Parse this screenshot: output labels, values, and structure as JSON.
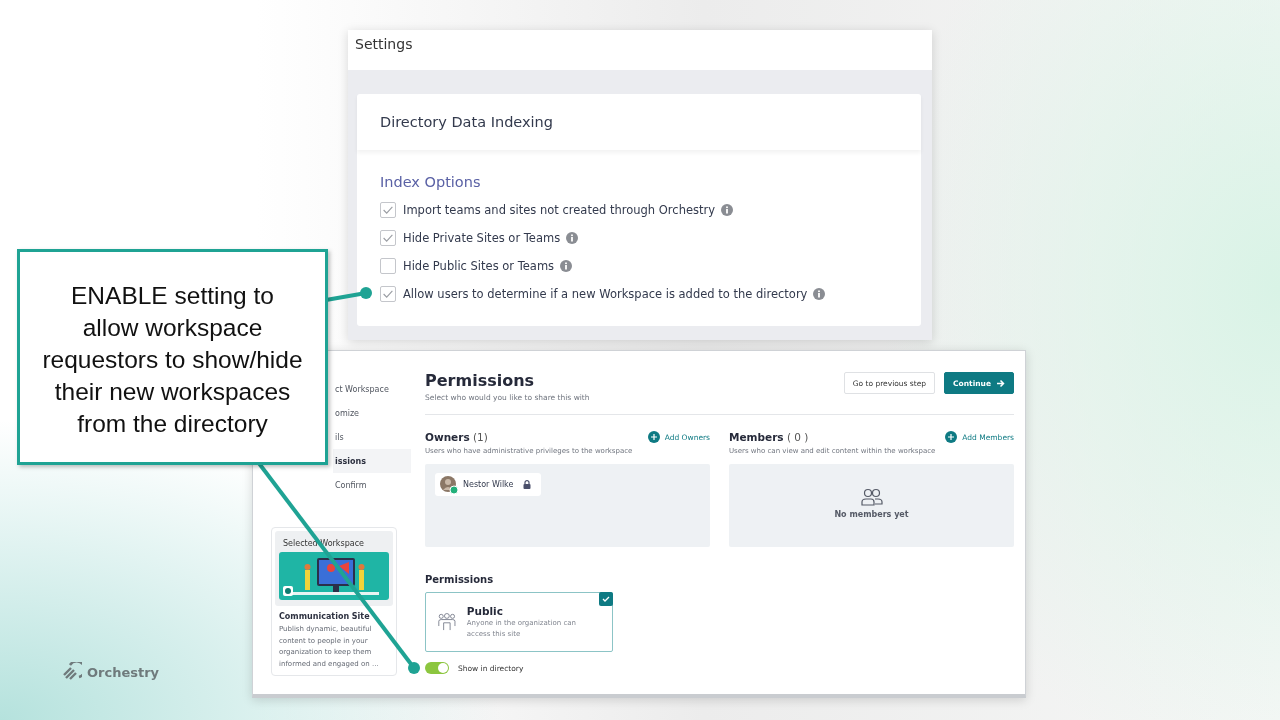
{
  "slide": {
    "callout": {
      "text": "ENABLE setting to allow workspace requestors to show/hide their new workspaces from the directory"
    },
    "logo": {
      "text": "Orchestry"
    }
  },
  "settings_window": {
    "title": "Settings",
    "section": {
      "title": "Directory Data Indexing",
      "group_title": "Index Options",
      "options": [
        {
          "label": "Import teams and sites not created through Orchestry",
          "checked": true
        },
        {
          "label": "Hide Private Sites or Teams",
          "checked": true
        },
        {
          "label": "Hide Public Sites or Teams",
          "checked": false
        },
        {
          "label": "Allow users to determine if a new Workspace is added to the directory",
          "checked": true
        }
      ]
    }
  },
  "wizard_window": {
    "steps": [
      {
        "label": "ct Workspace",
        "selected": false
      },
      {
        "label": "omize",
        "selected": false
      },
      {
        "label": "ils",
        "selected": false
      },
      {
        "label": "issions",
        "selected": true
      },
      {
        "label": "Confirm",
        "selected": false
      }
    ],
    "selected_card": {
      "title": "Selected Workspace",
      "name": "Communication Site",
      "description": "Publish dynamic, beautiful content to people in your organization to keep them informed and engaged on ..."
    },
    "title": "Permissions",
    "subtitle": "Select who would you like to share this with",
    "buttons": [
      {
        "label": "Go to previous step",
        "kind": "secondary"
      },
      {
        "label": "Continue",
        "kind": "primary"
      }
    ],
    "owners": {
      "title": "Owners",
      "count": "(1)",
      "add": "Add Owners",
      "description": "Users who have administrative privileges to the workspace",
      "people": [
        {
          "name": "Nestor Wilke",
          "locked": true
        }
      ]
    },
    "members": {
      "title": "Members",
      "count": "( 0 )",
      "add": "Add Members",
      "description": "Users who can view and edit content within the workspace",
      "empty": "No members yet"
    },
    "permissions": {
      "title": "Permissions",
      "options": [
        {
          "title": "Public",
          "description": "Anyone in the organization can access this site",
          "selected": true
        }
      ]
    },
    "show_in_directory": {
      "label": "Show in directory",
      "on": true
    }
  }
}
